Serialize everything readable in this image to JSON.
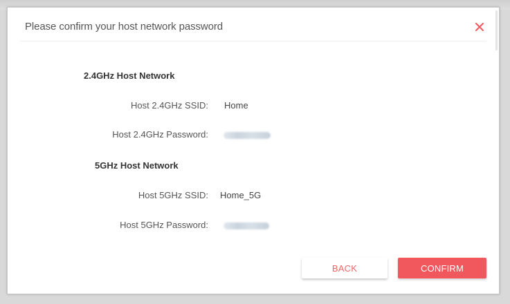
{
  "dialog": {
    "title": "Please confirm your host network password",
    "close_icon": "close-icon",
    "accent_color": "#f1585d"
  },
  "sections": [
    {
      "title": "2.4GHz Host Network",
      "fields": [
        {
          "label": "Host 2.4GHz SSID:",
          "value": "Home"
        },
        {
          "label": "Host 2.4GHz Password:",
          "value": ""
        }
      ]
    },
    {
      "title": "5GHz Host Network",
      "fields": [
        {
          "label": "Host 5GHz SSID:",
          "value": "Home_5G"
        },
        {
          "label": "Host 5GHz Password:",
          "value": ""
        }
      ]
    }
  ],
  "buttons": {
    "back": "BACK",
    "confirm": "CONFIRM"
  }
}
